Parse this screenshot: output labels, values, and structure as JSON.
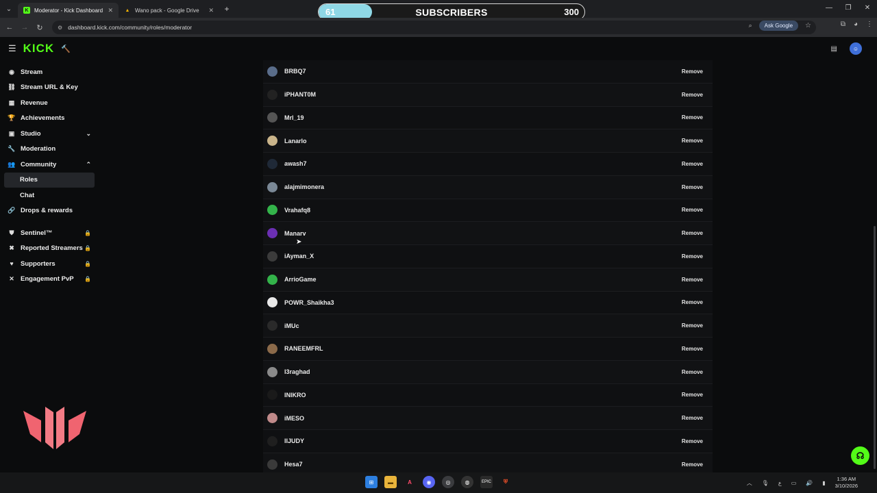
{
  "browser": {
    "tabs": [
      {
        "title": "Moderator - Kick Dashboard",
        "favicon": "K",
        "favicon_color": "#53fc18",
        "active": true
      },
      {
        "title": "Wano pack - Google Drive",
        "favicon": "▲",
        "favicon_color": "#f4b400",
        "active": false
      }
    ],
    "url": "dashboard.kick.com/community/roles/moderator",
    "ask_google": "Ask Google"
  },
  "subscribers_overlay": {
    "current": "61",
    "label": "SUBSCRIBERS",
    "goal": "300",
    "progress": 0.2
  },
  "header": {
    "logo": "KICK"
  },
  "sidebar": {
    "items": [
      {
        "label": "Stream",
        "icon": "radio-icon",
        "glyph": "◉"
      },
      {
        "label": "Stream URL & Key",
        "icon": "link-icon",
        "glyph": "⛓"
      },
      {
        "label": "Revenue",
        "icon": "bank-icon",
        "glyph": "▦"
      },
      {
        "label": "Achievements",
        "icon": "trophy-icon",
        "glyph": "🏆"
      },
      {
        "label": "Studio",
        "icon": "studio-icon",
        "glyph": "▣"
      },
      {
        "label": "Moderation",
        "icon": "wrench-icon",
        "glyph": "🔧"
      },
      {
        "label": "Community",
        "icon": "people-icon",
        "glyph": "👥"
      },
      {
        "label": "Roles"
      },
      {
        "label": "Chat"
      },
      {
        "label": "Drops & rewards",
        "icon": "drop-icon",
        "glyph": "🔗"
      },
      {
        "label": "Sentinel™",
        "icon": "shield-icon",
        "glyph": "⛊"
      },
      {
        "label": "Reported Streamers",
        "icon": "flag-icon",
        "glyph": "✖"
      },
      {
        "label": "Supporters",
        "icon": "heart-icon",
        "glyph": "♥"
      },
      {
        "label": "Engagement PvP",
        "icon": "swords-icon",
        "glyph": "✕"
      }
    ]
  },
  "moderators": {
    "remove_label": "Remove",
    "rows": [
      {
        "name": "BRBQ7",
        "color": "#5a6d8a"
      },
      {
        "name": "iPHANT0M",
        "color": "#222222"
      },
      {
        "name": "Mrl_19",
        "color": "#555555"
      },
      {
        "name": "Lanarlo",
        "color": "#c9b48a"
      },
      {
        "name": "awash7",
        "color": "#1f2937"
      },
      {
        "name": "alajmimonera",
        "color": "#7a8896"
      },
      {
        "name": "Vrahafq8",
        "color": "#33b34a"
      },
      {
        "name": "Manarv",
        "color": "#6b2fb3"
      },
      {
        "name": "iAyman_X",
        "color": "#3b3b3b"
      },
      {
        "name": "ArrioGame",
        "color": "#33b34a"
      },
      {
        "name": "POWR_Shaikha3",
        "color": "#e8e8e8"
      },
      {
        "name": "iMUc",
        "color": "#2a2a2a"
      },
      {
        "name": "RANEEMFRL",
        "color": "#8b6a4a"
      },
      {
        "name": "I3raghad",
        "color": "#8a8a8a"
      },
      {
        "name": "INIKRO",
        "color": "#1a1a1a"
      },
      {
        "name": "iMESO",
        "color": "#c08a8a"
      },
      {
        "name": "IIJUDY",
        "color": "#1f1f1f"
      },
      {
        "name": "Hesa7",
        "color": "#3a3a3a"
      }
    ]
  },
  "taskbar": {
    "time": "1:36 AM",
    "date": "3/10/2026"
  }
}
